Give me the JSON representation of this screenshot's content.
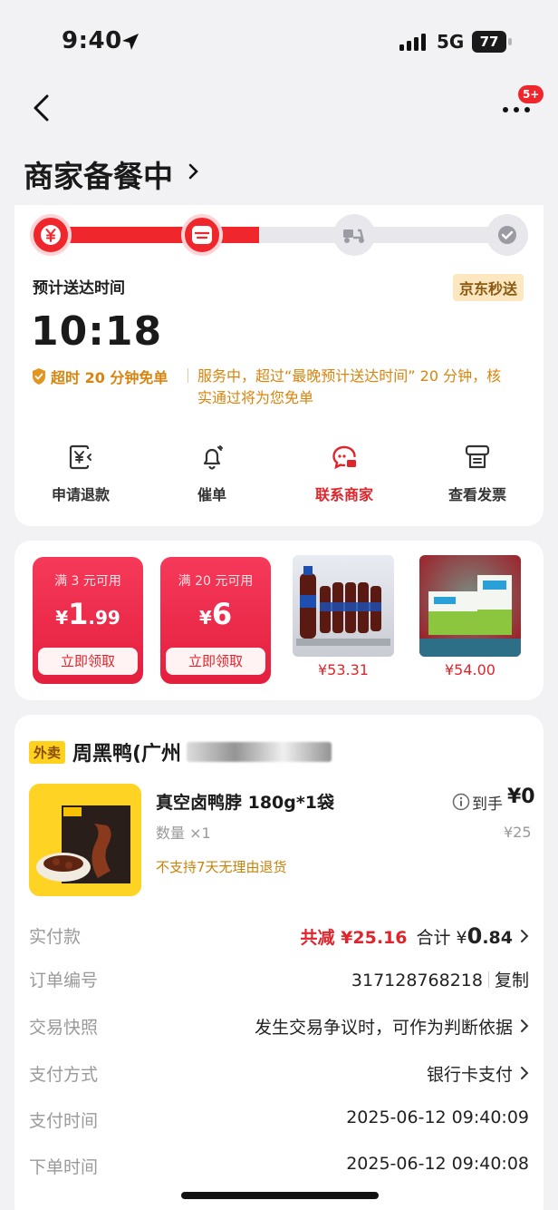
{
  "status_bar": {
    "time": "9:40",
    "network": "5G",
    "battery": "77"
  },
  "nav": {
    "badge": "5+",
    "title": "商家备餐中"
  },
  "delivery": {
    "eta_label": "预计送达时间",
    "service_tag": "京东秒送",
    "eta_time": "10:18",
    "guarantee_label": "超时 20 分钟免单",
    "guarantee_desc": "服务中，超过“最晚预计送达时间” 20 分钟，核实通过将为您免单",
    "progress_fraction": 0.46
  },
  "actions": [
    {
      "label": "申请退款",
      "icon": "refund-icon"
    },
    {
      "label": "催单",
      "icon": "bell-icon"
    },
    {
      "label": "联系商家",
      "icon": "merchant-chat-icon"
    },
    {
      "label": "查看发票",
      "icon": "invoice-icon"
    }
  ],
  "coupons": [
    {
      "condition": "满 3 元可用",
      "currency": "¥",
      "amount_big": "1",
      "amount_small": ".99",
      "button": "立即领取"
    },
    {
      "condition": "满 20 元可用",
      "currency": "¥",
      "amount_big": "6",
      "amount_small": "",
      "button": "立即领取"
    }
  ],
  "recommended": [
    {
      "price": "¥53.31"
    },
    {
      "price": "¥54.00"
    }
  ],
  "order": {
    "channel_tag": "外卖",
    "store_name": "周黑鸭(广州",
    "item": {
      "name": "真空卤鸭脖 180g*1袋",
      "quantity": "数量 ×1",
      "policy": "不支持7天无理由退货",
      "net_label": "到手",
      "net_price": "¥0",
      "original_price": "¥25"
    },
    "rows": {
      "paid": {
        "label": "实付款",
        "discount": "共减 ¥25.16",
        "total_prefix": "合计 ¥",
        "total_big": "0",
        "total_small": ".84"
      },
      "order_no": {
        "label": "订单编号",
        "value": "317128768218",
        "copy": "复制"
      },
      "snapshot": {
        "label": "交易快照",
        "value": "发生交易争议时，可作为判断依据"
      },
      "pay_method": {
        "label": "支付方式",
        "value": "银行卡支付"
      },
      "pay_time": {
        "label": "支付时间",
        "value": "2025-06-12 09:40:09"
      },
      "order_time": {
        "label": "下单时间",
        "value": "2025-06-12 09:40:08"
      }
    }
  }
}
